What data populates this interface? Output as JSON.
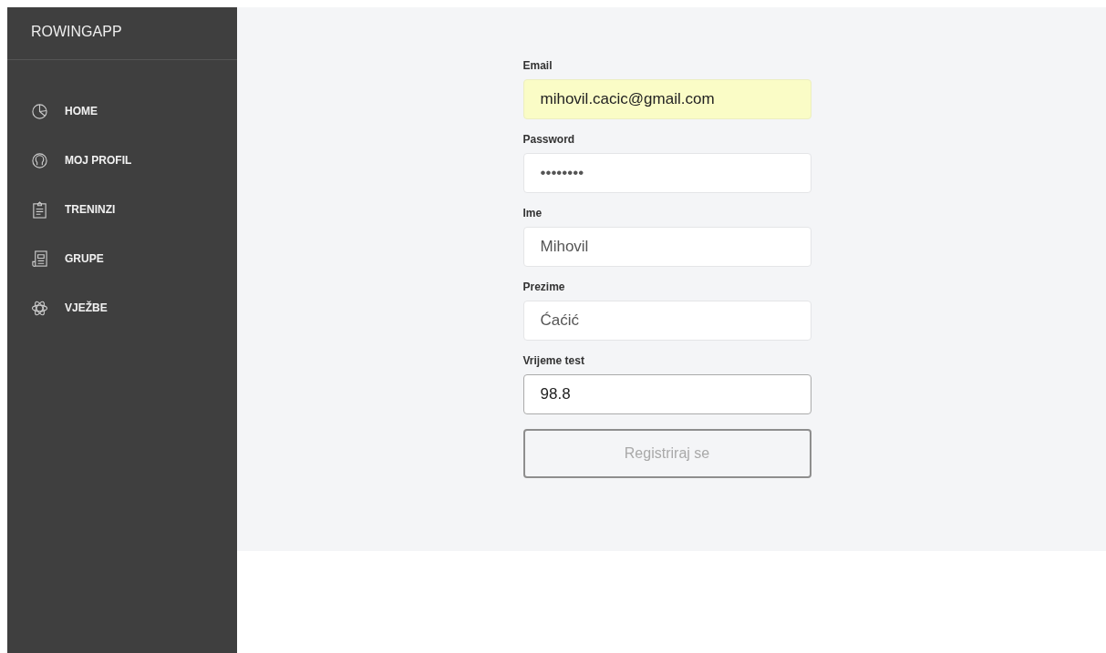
{
  "sidebar": {
    "title": "ROWINGAPP",
    "items": [
      {
        "label": "HOME"
      },
      {
        "label": "MOJ PROFIL"
      },
      {
        "label": "TRENINZI"
      },
      {
        "label": "GRUPE"
      },
      {
        "label": "VJEŽBE"
      }
    ]
  },
  "form": {
    "fields": [
      {
        "label": "Email",
        "value": "mihovil.cacic@gmail.com",
        "autofilled": true,
        "focused": false
      },
      {
        "label": "Password",
        "value": "••••••••",
        "autofilled": false,
        "focused": false
      },
      {
        "label": "Ime",
        "value": "Mihovil",
        "autofilled": false,
        "focused": false
      },
      {
        "label": "Prezime",
        "value": "Ćaćić",
        "autofilled": false,
        "focused": false
      },
      {
        "label": "Vrijeme test",
        "value": "98.8",
        "autofilled": false,
        "focused": true
      }
    ],
    "submit": {
      "label": "Registriraj se",
      "disabled": true
    }
  }
}
